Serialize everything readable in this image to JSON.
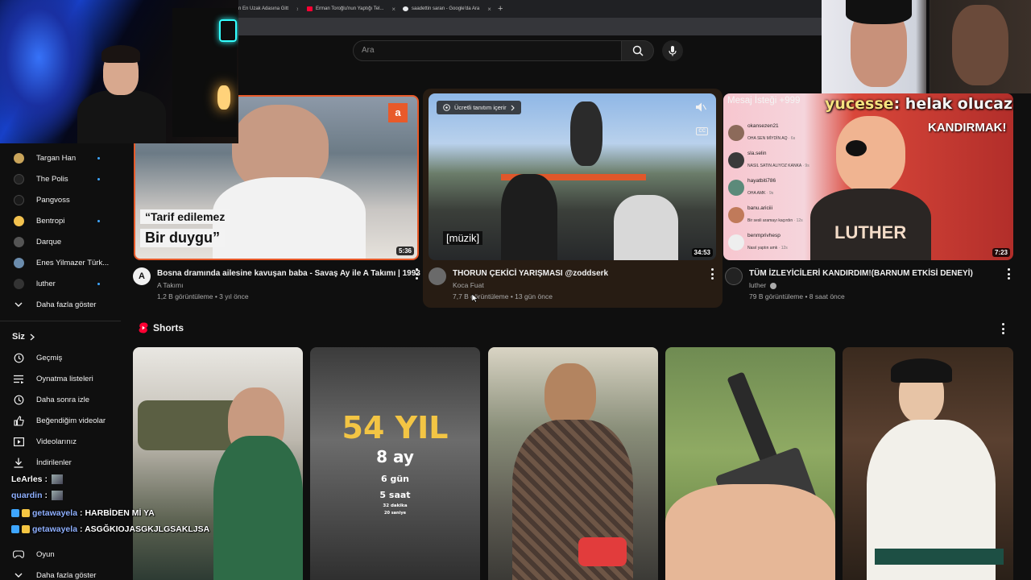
{
  "browser": {
    "tabs": [
      {
        "label": "n En Uzak Adasına Gitt"
      },
      {
        "label": "Erman Toroğlu'nun Yaptığı Tel..."
      },
      {
        "label": "saadettin saran - Google'da Ara"
      }
    ],
    "new_tab": "+"
  },
  "masthead": {
    "search_placeholder": "Ara"
  },
  "chat_top": {
    "user": "yucesse",
    "message": ": helak olucaz"
  },
  "sidebar": {
    "subscriptions": [
      {
        "label": "Targan Han",
        "avatar_color": "#c9a45a",
        "live": true
      },
      {
        "label": "The Polis",
        "avatar_color": "#222222",
        "live": true
      },
      {
        "label": "Pangvoss",
        "avatar_color": "#1a1a1a",
        "live": false
      },
      {
        "label": "Bentropi",
        "avatar_color": "#f2c14e",
        "live": true
      },
      {
        "label": "Darque",
        "avatar_color": "#555555",
        "live": false
      },
      {
        "label": "Enes Yilmazer Türk...",
        "avatar_color": "#6b8cad",
        "live": false
      },
      {
        "label": "luther",
        "avatar_color": "#333333",
        "live": true
      }
    ],
    "show_more_1": "Daha fazla göster",
    "you_section": "Siz",
    "you_items": [
      {
        "label": "Geçmiş",
        "icon": "history-icon"
      },
      {
        "label": "Oynatma listeleri",
        "icon": "playlist-icon"
      },
      {
        "label": "Daha sonra izle",
        "icon": "clock-icon"
      },
      {
        "label": "Beğendiğim videolar",
        "icon": "thumbs-up-icon"
      },
      {
        "label": "Videolarınız",
        "icon": "video-icon"
      },
      {
        "label": "İndirilenler",
        "icon": "download-icon"
      }
    ],
    "explore_items": [
      {
        "label": "Oyun",
        "icon": "gaming-icon"
      }
    ],
    "show_more_2": "Daha fazla göster"
  },
  "chat": [
    {
      "user": "LeArles",
      "text": " :"
    },
    {
      "user": "quardin",
      "text": " :"
    },
    {
      "user": "getawayela",
      "text": " : HARBİDEN Mİ YA"
    },
    {
      "user": "getawayela",
      "text": " : ASGĞKIOJASGKJLGSAKLJSA"
    }
  ],
  "videos": [
    {
      "title": "Bosna dramında ailesine kavuşan baba - Savaş Ay ile A Takımı | 1993",
      "channel": "A Takımı",
      "meta": "1,2 B görüntüleme • 3 yıl önce",
      "duration": "5:36",
      "caption1": "“Tarif edilemez",
      "caption2": "Bir duygu”"
    },
    {
      "title": "THORUN ÇEKİCİ YARIŞMASI @zoddserk",
      "channel": "Koca Fuat",
      "meta": "7,7 B görüntüleme • 13 gün önce",
      "duration": "34:53",
      "promo": "Ücretli tanıtım içerir",
      "caption": "[müzik]",
      "cc": "CC"
    },
    {
      "title": "TÜM İZLEYİCİLERİ KANDIRDIM!(BARNUM ETKİSİ DENEYİ)",
      "channel": "luther",
      "meta": "79 B görüntüleme • 8 saat önce",
      "duration": "7:23",
      "badge": "Mesaj İsteği +999",
      "banner": "KANDIRMAK!",
      "shirt": "LUTHER",
      "messages": [
        {
          "user": "okansezen21",
          "text": "OHA SEN MİYDİN AQ",
          "age": "6s"
        },
        {
          "user": "sla.selin",
          "text": "NASIL SATIN ALIYOZ KANKA",
          "age": "9s"
        },
        {
          "user": "hayatbiti786",
          "text": "OHA AMK",
          "age": "9s"
        },
        {
          "user": "banu.ariciii",
          "text": "Bir sesli aramayı kaçırdın",
          "age": "12s"
        },
        {
          "user": "benmprivhesp",
          "text": "Nasıl yaptın amk",
          "age": "12s"
        }
      ]
    }
  ],
  "shorts": {
    "title": "Shorts",
    "short2": {
      "line1": "54 YIL",
      "line2": "8 ay",
      "line3": "6 gün",
      "line4": "5 saat",
      "line5": "32 dakika",
      "line6": "20 saniye"
    }
  }
}
